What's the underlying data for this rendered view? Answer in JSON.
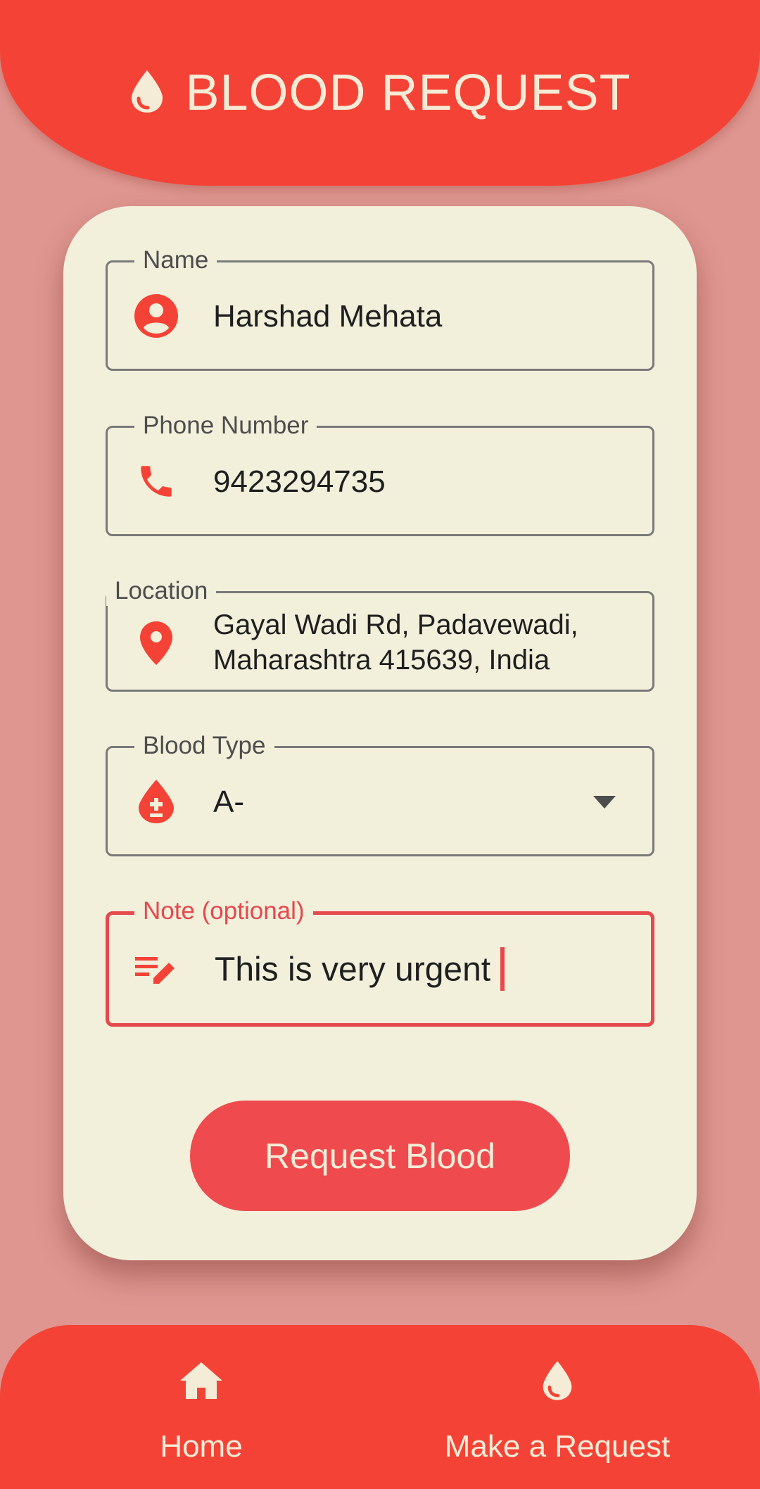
{
  "header": {
    "title": "BLOOD REQUEST",
    "icon": "blood-drop-icon"
  },
  "form": {
    "name": {
      "label": "Name",
      "value": "Harshad Mehata",
      "icon": "account-circle-icon"
    },
    "phone": {
      "label": "Phone Number",
      "value": "9423294735",
      "icon": "phone-icon"
    },
    "location": {
      "label": "Location",
      "line1": "Gayal Wadi Rd, Padavewadi,",
      "line2": "Maharashtra 415639, India",
      "icon": "location-pin-icon"
    },
    "blood_type": {
      "label": "Blood Type",
      "value": "A-",
      "icon": "blood-type-icon"
    },
    "note": {
      "label": "Note (optional)",
      "value": "This is very urgent",
      "icon": "edit-note-icon"
    },
    "submit_label": "Request Blood"
  },
  "bottom_nav": {
    "items": [
      {
        "label": "Home",
        "icon": "home-icon"
      },
      {
        "label": "Make a Request",
        "icon": "blood-drop-icon"
      }
    ]
  },
  "colors": {
    "primary": "#f44336",
    "accent": "#e5484d",
    "background": "#df9690",
    "card": "#f2efdb",
    "on_primary": "#f4ecd7"
  }
}
